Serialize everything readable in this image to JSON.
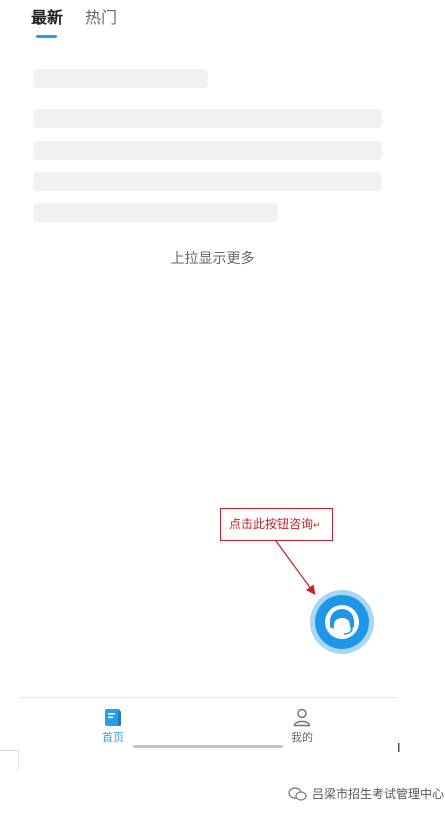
{
  "tabs": {
    "latest": "最新",
    "hot": "热门"
  },
  "load_more": "上拉显示更多",
  "callout": {
    "text": "点击此按钮咨询",
    "mark": "↵"
  },
  "fab": {
    "icon": "customer-service-headset-icon"
  },
  "bottom_nav": {
    "home": {
      "label": "首页",
      "icon": "home-book-icon"
    },
    "mine": {
      "label": "我的",
      "icon": "user-icon"
    }
  },
  "colors": {
    "accent": "#2a9de8",
    "callout_red": "#c7202a",
    "skeleton": "#f0f1f3"
  },
  "watermark": "吕梁市招生考试管理中心"
}
